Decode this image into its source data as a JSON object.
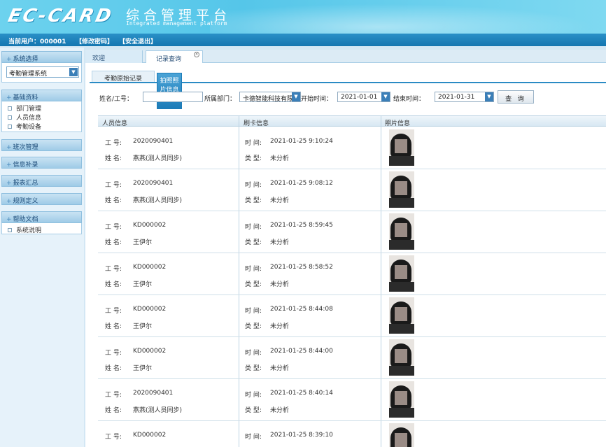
{
  "header": {
    "logo": "EC-CARD",
    "title_cn": "综合管理平台",
    "title_en": "Integrated management platform"
  },
  "userbar": {
    "current_user": "当前用户：000001",
    "change_password": "【修改密码】",
    "logout": "【安全退出】"
  },
  "sidebar": {
    "system_select_label": "系统选择",
    "system_selected": "考勤管理系统",
    "sections": [
      {
        "label": "基础资料",
        "items": [
          "部门管理",
          "人员信息",
          "考勤设备"
        ]
      },
      {
        "label": "班次管理",
        "items": []
      },
      {
        "label": "信息补录",
        "items": []
      },
      {
        "label": "报表汇总",
        "items": []
      },
      {
        "label": "规则定义",
        "items": []
      },
      {
        "label": "帮助文档",
        "items": [
          "系统说明"
        ]
      }
    ]
  },
  "tabs": {
    "welcome": "欢迎",
    "records": "记录查询",
    "close_glyph": "×"
  },
  "subtabs": {
    "raw": "考勤原始记录",
    "photo": "拍照照片信息"
  },
  "filter": {
    "name_label": "姓名/工号：",
    "name_value": "",
    "dept_label": "所属部门：",
    "dept_value": "卡德智能科技有限",
    "start_label": "开始时间：",
    "start_value": "2021-01-01",
    "end_label": "结束时间：",
    "end_value": "2021-01-31",
    "search_button": "查 询"
  },
  "table": {
    "headers": [
      "人员信息",
      "刷卡信息",
      "照片信息"
    ],
    "id_label": "工  号:",
    "name_label": "姓  名:",
    "time_label": "时 间:",
    "type_label": "类 型:",
    "rows": [
      {
        "id": "2020090401",
        "name": "燕燕(测人员同步)",
        "time": "2021-01-25 9:10:24",
        "type": "未分析"
      },
      {
        "id": "2020090401",
        "name": "燕燕(测人员同步)",
        "time": "2021-01-25 9:08:12",
        "type": "未分析"
      },
      {
        "id": "KD000002",
        "name": "王伊尔",
        "time": "2021-01-25 8:59:45",
        "type": "未分析"
      },
      {
        "id": "KD000002",
        "name": "王伊尔",
        "time": "2021-01-25 8:58:52",
        "type": "未分析"
      },
      {
        "id": "KD000002",
        "name": "王伊尔",
        "time": "2021-01-25 8:44:08",
        "type": "未分析"
      },
      {
        "id": "KD000002",
        "name": "王伊尔",
        "time": "2021-01-25 8:44:00",
        "type": "未分析"
      },
      {
        "id": "2020090401",
        "name": "燕燕(测人员同步)",
        "time": "2021-01-25 8:40:14",
        "type": "未分析"
      },
      {
        "id": "KD000002",
        "name": "",
        "time": "2021-01-25 8:39:10",
        "type": ""
      }
    ]
  }
}
